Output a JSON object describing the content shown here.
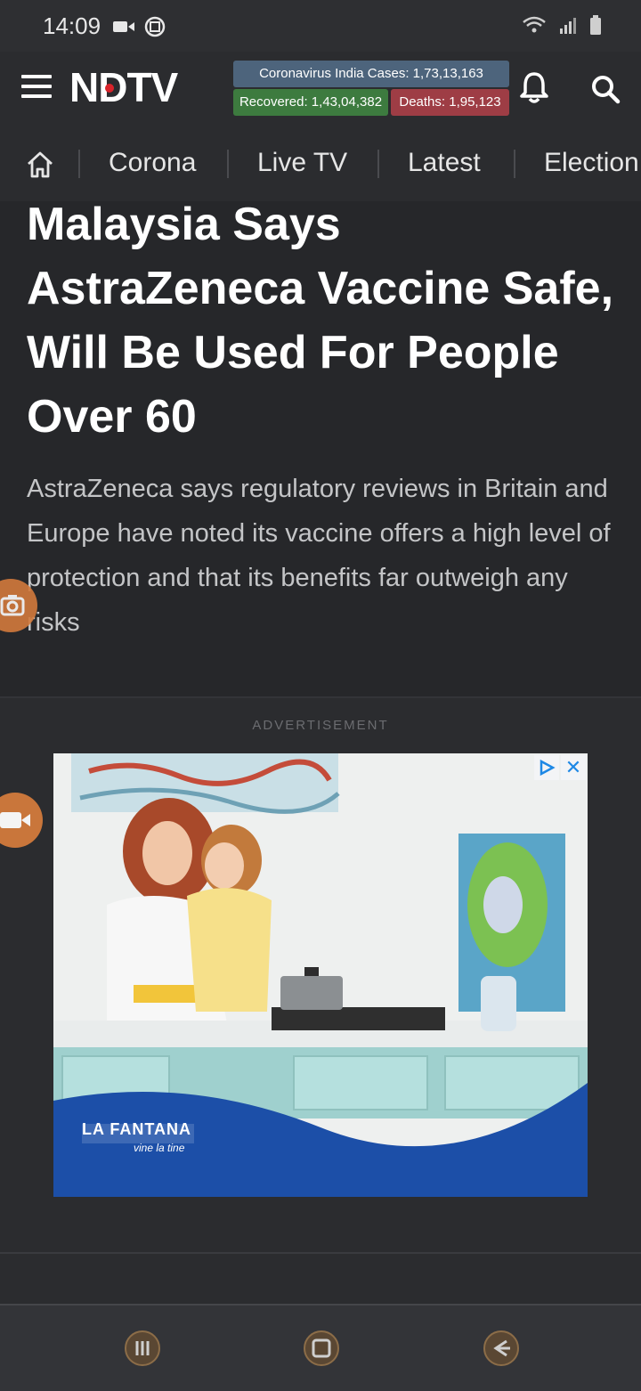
{
  "status": {
    "time": "14:09"
  },
  "header": {
    "logo": "NDTV"
  },
  "covid": {
    "cases": "Coronavirus India Cases: 1,73,13,163",
    "recovered": "Recovered: 1,43,04,382",
    "deaths": "Deaths: 1,95,123"
  },
  "nav": {
    "items": [
      "Corona",
      "Live TV",
      "Latest",
      "Election"
    ]
  },
  "article": {
    "headline": "Malaysia Says AstraZeneca Vaccine Safe, Will Be Used For People Over 60",
    "summary": "AstraZeneca says regulatory reviews in Britain and Europe have noted its vaccine offers a high level of protection and that its benefits far outweigh any risks"
  },
  "ad": {
    "label": "ADVERTISEMENT",
    "brand": "LA FANTANA",
    "slogan": "vine la tine"
  },
  "colors": {
    "accent_red": "#d8232a",
    "cases_bg": "#4d647c",
    "recovered_bg": "#3d7b3f",
    "deaths_bg": "#9e3d45",
    "fab_orange": "#d27a3c"
  }
}
